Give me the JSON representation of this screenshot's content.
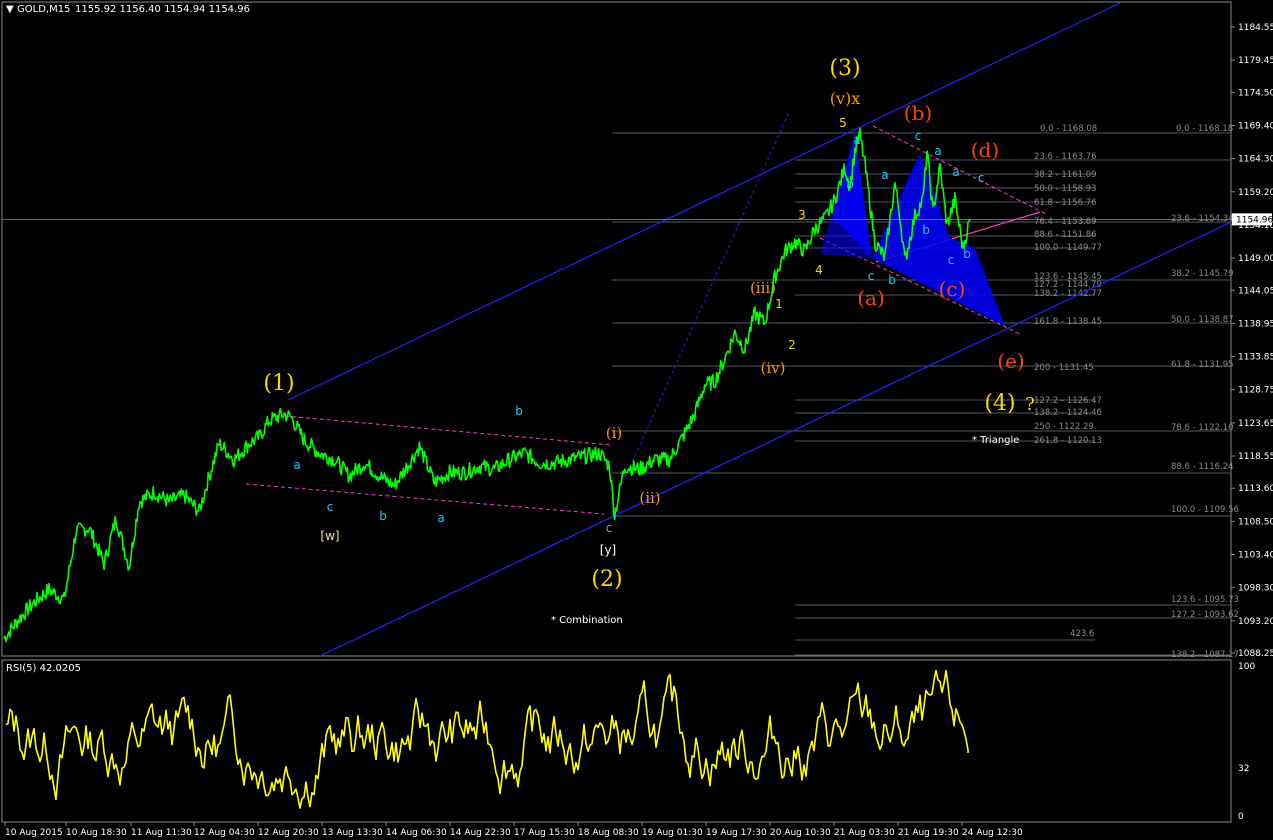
{
  "header": {
    "symbol": "GOLD,M15",
    "ohlc": "1155.92 1156.40 1154.94 1154.96",
    "triangle_glyph": "▼"
  },
  "rsi_label": "RSI(5) 42.0205",
  "colors": {
    "background": "#000000",
    "price": "#00ff00",
    "rsi": "#ffff00",
    "channel": "#2323ff",
    "fib": "#4c5a66",
    "pink": "#ff3cc8",
    "wave_yellow": "#ffd700",
    "wave_orange": "#ff9900",
    "wave_red": "#ff4500",
    "wave_cyan": "#1ec8ff",
    "triangle_fill": "#0000ff"
  },
  "chart_data": {
    "type": "line",
    "instrument": "GOLD",
    "timeframe": "M15",
    "current_price": "1154.96",
    "price_axis": {
      "ticks": [
        "1184.55",
        "1179.45",
        "1174.50",
        "1169.40",
        "1164.30",
        "1159.20",
        "1154.10",
        "1149.00",
        "1144.05",
        "1138.95",
        "1133.85",
        "1128.75",
        "1123.65",
        "1118.55",
        "1113.60",
        "1108.50",
        "1103.40",
        "1098.30",
        "1093.20",
        "1088.25"
      ],
      "range": [
        1086.0,
        1189.5
      ]
    },
    "time_axis": {
      "ticks": [
        "10 Aug 2015",
        "10 Aug 18:30",
        "11 Aug 11:30",
        "12 Aug 04:30",
        "12 Aug 20:30",
        "13 Aug 13:30",
        "14 Aug 06:30",
        "14 Aug 22:30",
        "17 Aug 15:30",
        "18 Aug 08:30",
        "19 Aug 01:30",
        "19 Aug 17:30",
        "20 Aug 10:30",
        "21 Aug 03:30",
        "21 Aug 19:30",
        "24 Aug 12:30"
      ]
    },
    "price_series": {
      "name": "GOLD,M15",
      "x_index": [
        0,
        15,
        30,
        45,
        60,
        72,
        85,
        100,
        112,
        125,
        135,
        150,
        165,
        180,
        195,
        205,
        215,
        230,
        245,
        255,
        265,
        272,
        280,
        287,
        300,
        315,
        330,
        345,
        360,
        375,
        390,
        405,
        415,
        430,
        445,
        460,
        475,
        490,
        505,
        520,
        535,
        550,
        565,
        580,
        595,
        605,
        610,
        620,
        635,
        650,
        665,
        680,
        690,
        700,
        710,
        720,
        730,
        740,
        750,
        760,
        770,
        780,
        790,
        800,
        810,
        820,
        830,
        840,
        845,
        850,
        855,
        860,
        870,
        880,
        890,
        895,
        900,
        910,
        918,
        922,
        928,
        935,
        942,
        950,
        958,
        965
      ],
      "y": [
        1090.5,
        1093.5,
        1096.0,
        1098.0,
        1096.5,
        1107.0,
        1107.5,
        1102.0,
        1109.0,
        1101.5,
        1111.5,
        1113.0,
        1111.5,
        1112.5,
        1110.0,
        1115.5,
        1120.5,
        1118.0,
        1120.5,
        1121.5,
        1124.0,
        1124.5,
        1125.0,
        1124.5,
        1121.0,
        1119.0,
        1118.0,
        1115.5,
        1117.5,
        1115.5,
        1114.0,
        1117.5,
        1120.0,
        1114.5,
        1116.0,
        1116.0,
        1117.0,
        1116.5,
        1118.0,
        1119.0,
        1117.5,
        1117.5,
        1118.0,
        1118.5,
        1119.0,
        1117.0,
        1109.5,
        1117.0,
        1116.5,
        1118.0,
        1118.0,
        1122.0,
        1125.0,
        1129.5,
        1130.0,
        1133.5,
        1137.5,
        1135.0,
        1140.5,
        1139.0,
        1146.0,
        1150.0,
        1151.5,
        1150.0,
        1153.5,
        1155.0,
        1158.0,
        1163.0,
        1160.0,
        1165.5,
        1168.0,
        1163.5,
        1151.5,
        1149.0,
        1160.5,
        1155.5,
        1148.5,
        1155.5,
        1158.0,
        1165.5,
        1156.0,
        1163.0,
        1154.0,
        1158.0,
        1150.5,
        1155.0
      ]
    },
    "rsi_series": {
      "name": "RSI(5)",
      "range": [
        0,
        100
      ],
      "levels": [
        "100",
        "32",
        "0"
      ],
      "last_value": 42.0205
    },
    "fibonacci_labels": [
      {
        "text": "0.0 - 1168.08"
      },
      {
        "text": "0.0 - 1168.18"
      },
      {
        "text": "23.6 - 1163.76"
      },
      {
        "text": "38.2 - 1161.09"
      },
      {
        "text": "50.0 - 1158.93"
      },
      {
        "text": "61.8 - 1156.76"
      },
      {
        "text": "76.4 - 1153.69"
      },
      {
        "text": "23.6 - 1154.34"
      },
      {
        "text": "88.6 - 1151.86"
      },
      {
        "text": "100.0 - 1149.77"
      },
      {
        "text": "123.6 - 1145.45"
      },
      {
        "text": "38.2 - 1145.79"
      },
      {
        "text": "127.2 - 1144.79"
      },
      {
        "text": "138.2 - 1142.77"
      },
      {
        "text": "161.8 - 1138.45"
      },
      {
        "text": "50.0 - 1138.87"
      },
      {
        "text": "200 - 1131.45"
      },
      {
        "text": "61.8 - 1131.95"
      },
      {
        "text": "127.2 - 1126.47"
      },
      {
        "text": "138.2 - 1124.46"
      },
      {
        "text": "250 - 1122.29"
      },
      {
        "text": "78.6 - 1122.10"
      },
      {
        "text": "261.8 - 1120.13"
      },
      {
        "text": "88.6 - 1116.24"
      },
      {
        "text": "100.0 - 1109.56"
      },
      {
        "text": "123.6 - 1095.73"
      },
      {
        "text": "127.2 - 1093.62"
      },
      {
        "text": "423.6"
      },
      {
        "text": "138.2 - 1087.17"
      }
    ],
    "wave_labels": [
      {
        "text": "(1)",
        "color": "#ffd700"
      },
      {
        "text": "(2)",
        "color": "#ffd700"
      },
      {
        "text": "(3)",
        "color": "#ffd700"
      },
      {
        "text": "(4)",
        "color": "#ffd700"
      },
      {
        "text": "?",
        "color": "#ffd700"
      },
      {
        "text": "(v)x",
        "color": "#ff9900"
      },
      {
        "text": "(iii)",
        "color": "#ff9900"
      },
      {
        "text": "(iv)",
        "color": "#ff9900"
      },
      {
        "text": "(i)",
        "color": "#ff9900"
      },
      {
        "text": "(ii)",
        "color": "#ff9900"
      },
      {
        "text": "5",
        "color": "#ffd700"
      },
      {
        "text": "3",
        "color": "#ffd700"
      },
      {
        "text": "4",
        "color": "#ffd700"
      },
      {
        "text": "1",
        "color": "#ffd700"
      },
      {
        "text": "2",
        "color": "#ffd700"
      },
      {
        "text": "(a)",
        "color": "#ff4500"
      },
      {
        "text": "(b)",
        "color": "#ff4500"
      },
      {
        "text": "(c)",
        "color": "#ff4500"
      },
      {
        "text": "(d)",
        "color": "#ff4500"
      },
      {
        "text": "(e)",
        "color": "#ff4500"
      },
      {
        "text": "[w]",
        "color": "#f5deb3"
      },
      {
        "text": "[y]",
        "color": "#ffffff"
      },
      {
        "text": "a",
        "color": "#1ec8ff"
      },
      {
        "text": "c",
        "color": "#1ec8ff"
      },
      {
        "text": "b",
        "color": "#1ec8ff"
      },
      {
        "text": "b",
        "color": "#1ec8ff"
      },
      {
        "text": "a",
        "color": "#1ec8ff"
      },
      {
        "text": "c",
        "color": "#1ec8ff"
      },
      {
        "text": "b",
        "color": "#1ec8ff"
      },
      {
        "text": "a",
        "color": "#1ec8ff"
      },
      {
        "text": "c",
        "color": "#1ec8ff"
      },
      {
        "text": "b",
        "color": "#1ec8ff"
      },
      {
        "text": "a",
        "color": "#1ec8ff"
      },
      {
        "text": "c",
        "color": "#1ec8ff"
      },
      {
        "text": "b",
        "color": "#1ec8ff"
      },
      {
        "text": "a",
        "color": "#1ec8ff"
      },
      {
        "text": "c",
        "color": "#1ec8ff"
      },
      {
        "text": "a",
        "color": "#1ec8ff"
      },
      {
        "text": "c",
        "color": "#1ec8ff"
      },
      {
        "text": "b",
        "color": "#1ec8ff"
      }
    ],
    "annotations": [
      "* Combination",
      "* Triangle"
    ],
    "grid": false
  }
}
